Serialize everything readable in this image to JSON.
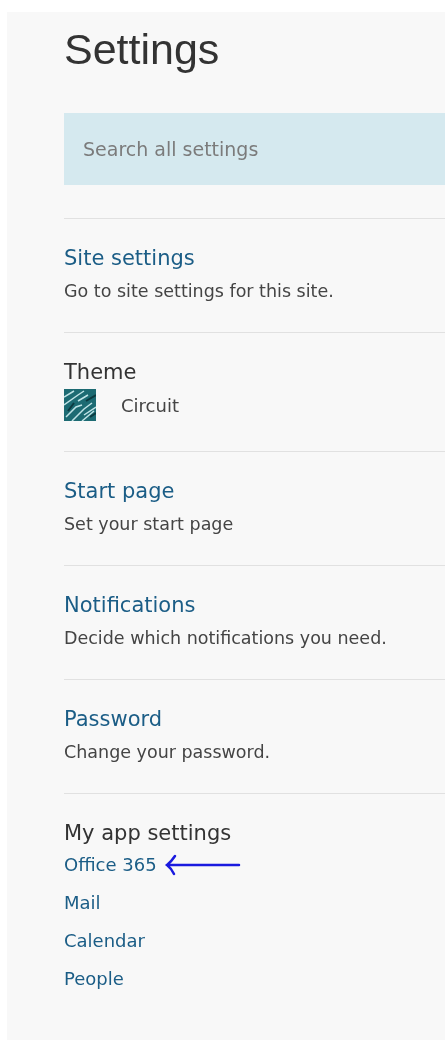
{
  "title": "Settings",
  "search": {
    "placeholder": "Search all settings"
  },
  "sections": [
    {
      "kind": "link",
      "title": "Site settings",
      "description": "Go to site settings for this site."
    },
    {
      "kind": "theme",
      "title": "Theme",
      "theme_name": "Circuit"
    },
    {
      "kind": "link",
      "title": "Start page",
      "description": "Set your start page"
    },
    {
      "kind": "link",
      "title": "Notifications",
      "description": "Decide which notifications you need."
    },
    {
      "kind": "link",
      "title": "Password",
      "description": "Change your password."
    },
    {
      "kind": "apps",
      "title": "My app settings",
      "links": [
        {
          "label": "Office 365",
          "annotated": true
        },
        {
          "label": "Mail",
          "annotated": false
        },
        {
          "label": "Calendar",
          "annotated": false
        },
        {
          "label": "People",
          "annotated": false
        }
      ]
    }
  ]
}
